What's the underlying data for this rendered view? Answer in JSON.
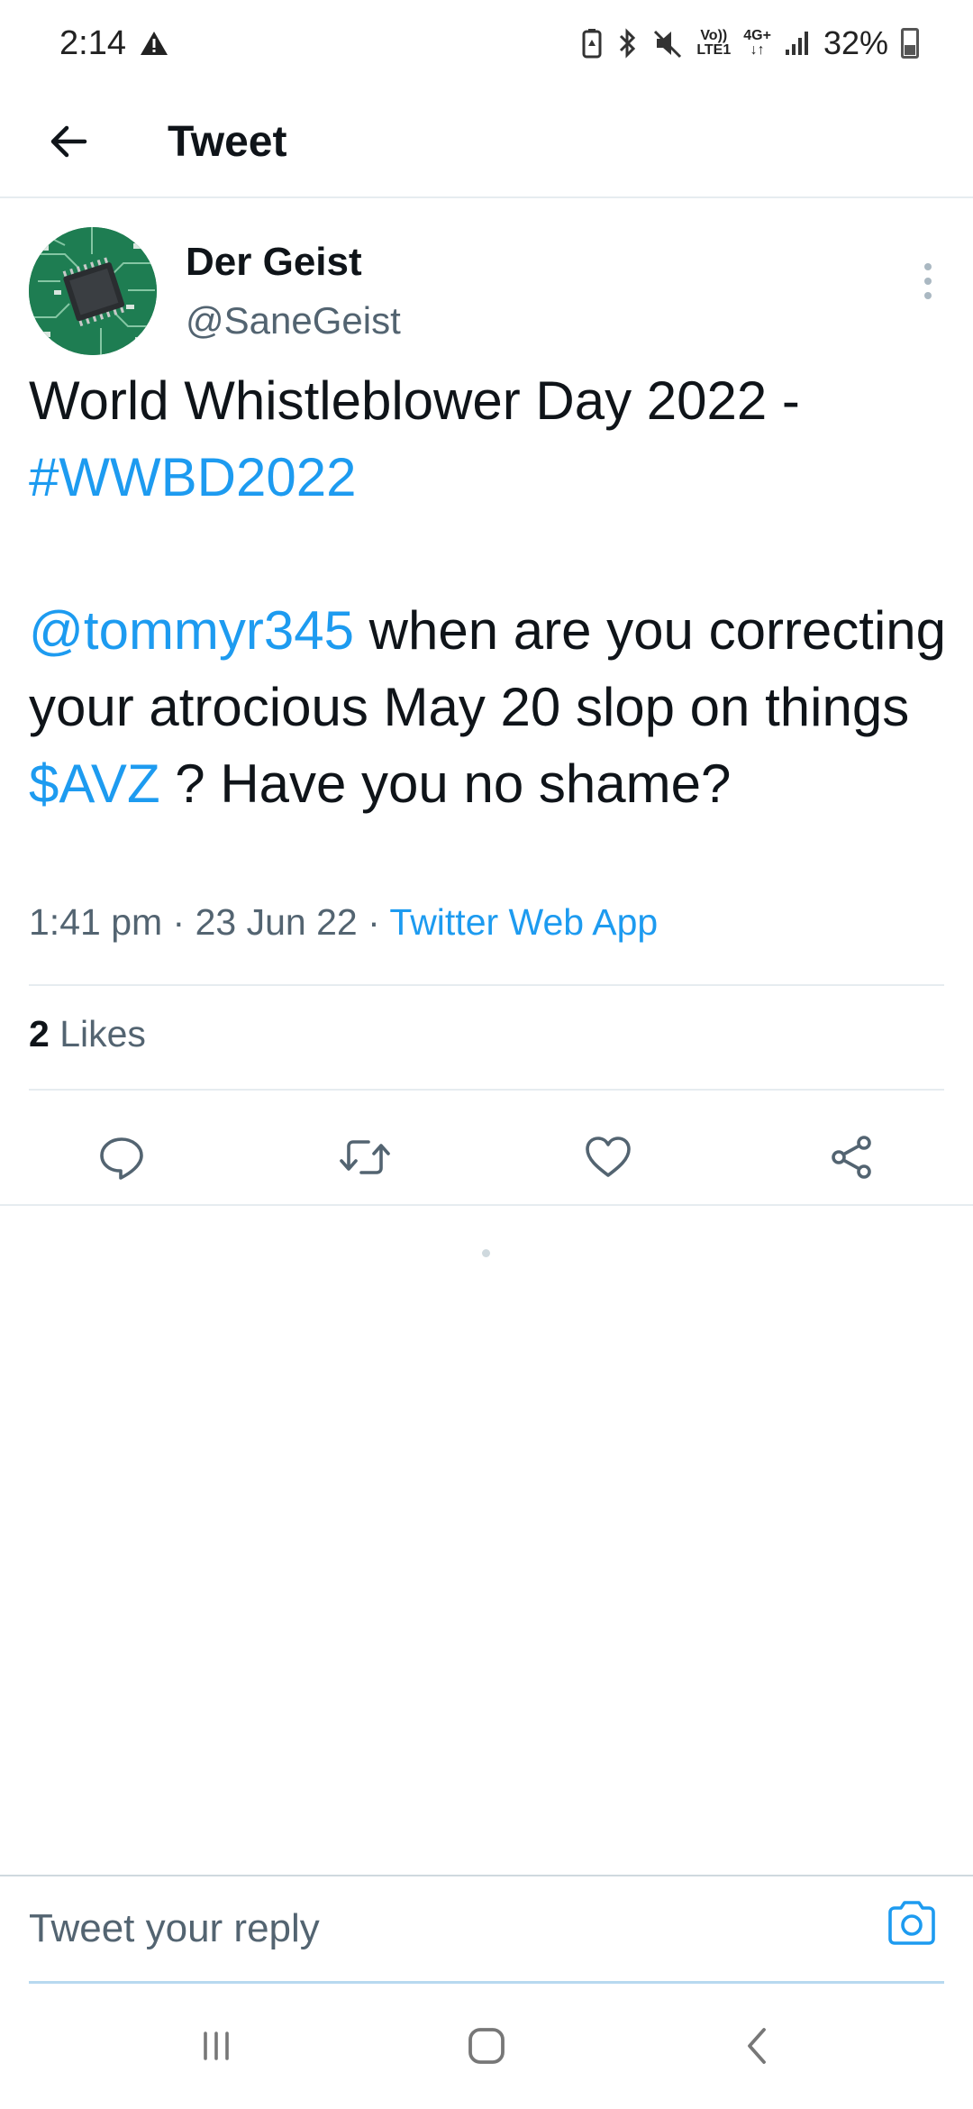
{
  "status_bar": {
    "time": "2:14",
    "network_top": "Vo))",
    "network_bottom": "LTE1",
    "data_top": "4G+",
    "data_bottom": "↓↑",
    "battery": "32%"
  },
  "app_bar": {
    "title": "Tweet"
  },
  "tweet": {
    "author_name": "Der Geist",
    "author_handle": "@SaneGeist",
    "text_line1": "World Whistleblower Day 2022 -",
    "hashtag": "#WWBD2022",
    "mention": "@tommyr345",
    "text_part1": " when are you correcting your atrocious May 20 slop on things ",
    "cashtag": "$AVZ",
    "text_part2": " ? Have you no shame?",
    "time": "1:41 pm",
    "separator": " · ",
    "date": "23 Jun 22",
    "source": "Twitter Web App",
    "likes_count": "2",
    "likes_label": " Likes"
  },
  "reply": {
    "placeholder": "Tweet your reply"
  },
  "colors": {
    "accent": "#1d9bf0",
    "text": "#0f1419",
    "secondary": "#536471",
    "divider": "#e6ecf0"
  }
}
